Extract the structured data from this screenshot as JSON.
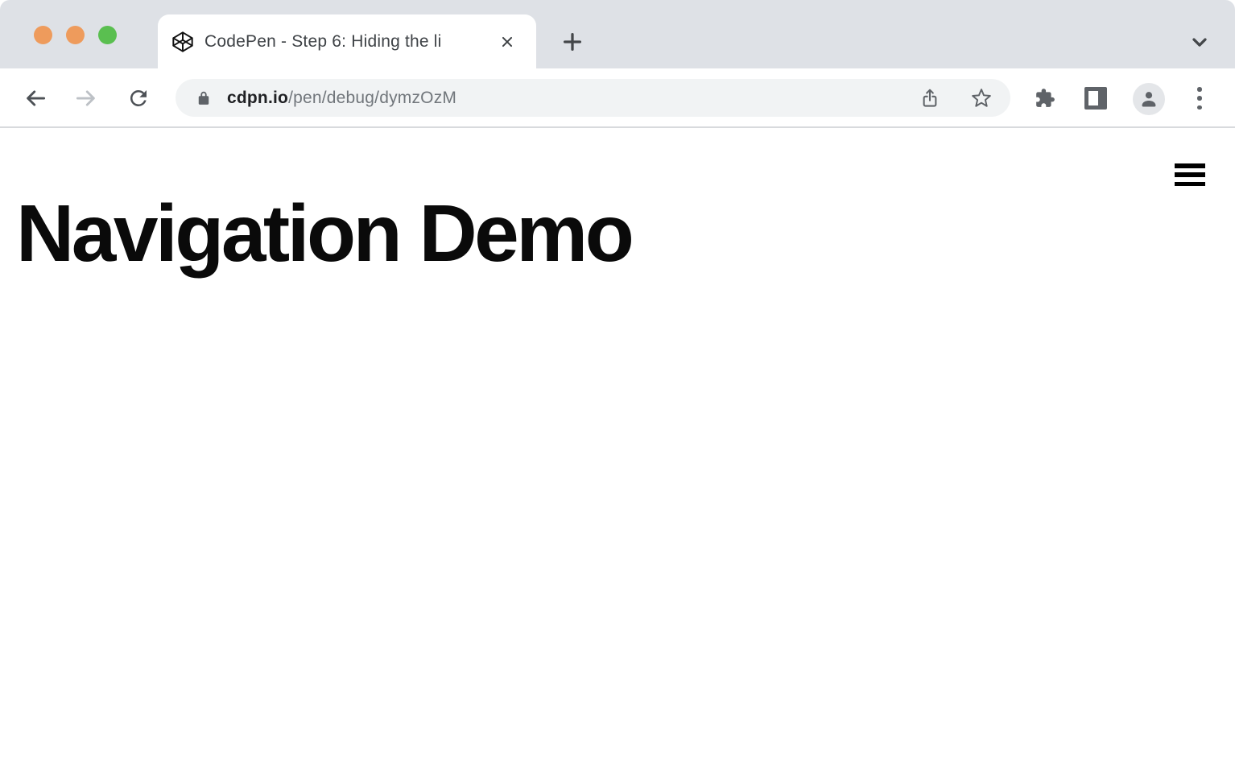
{
  "window": {
    "traffic_lights": [
      {
        "name": "close-light",
        "color": "#ee9b5c"
      },
      {
        "name": "minimize-light",
        "color": "#ee9b5c"
      },
      {
        "name": "zoom-light",
        "color": "#5abf50"
      }
    ]
  },
  "tab_bar": {
    "tab": {
      "favicon": "codepen-icon",
      "title": "CodePen - Step 6: Hiding the li",
      "close_icon": "x-icon"
    },
    "new_tab_icon": "plus-icon",
    "tab_search_icon": "chevron-down-icon"
  },
  "toolbar": {
    "back_icon": "arrow-left-icon",
    "forward_icon": "arrow-right-icon",
    "reload_icon": "refresh-icon",
    "omnibox": {
      "security_icon": "lock-icon",
      "url_domain": "cdpn.io",
      "url_path": "/pen/debug/dymzOzM"
    },
    "share_icon": "share-icon",
    "bookmark_icon": "star-icon",
    "extensions_icon": "puzzle-icon",
    "side_panel_icon": "side-panel-icon",
    "profile_icon": "person-icon",
    "menu_icon": "three-dots-icon"
  },
  "page": {
    "menu_icon": "hamburger-icon",
    "heading": "Navigation Demo"
  },
  "colors": {
    "tabstrip_bg": "#dee1e6",
    "omnibox_bg": "#f1f3f4",
    "icon_gray": "#5f6368",
    "disabled_gray": "#bdc1c6",
    "url_dark": "#202124",
    "url_gray": "#71767b"
  }
}
